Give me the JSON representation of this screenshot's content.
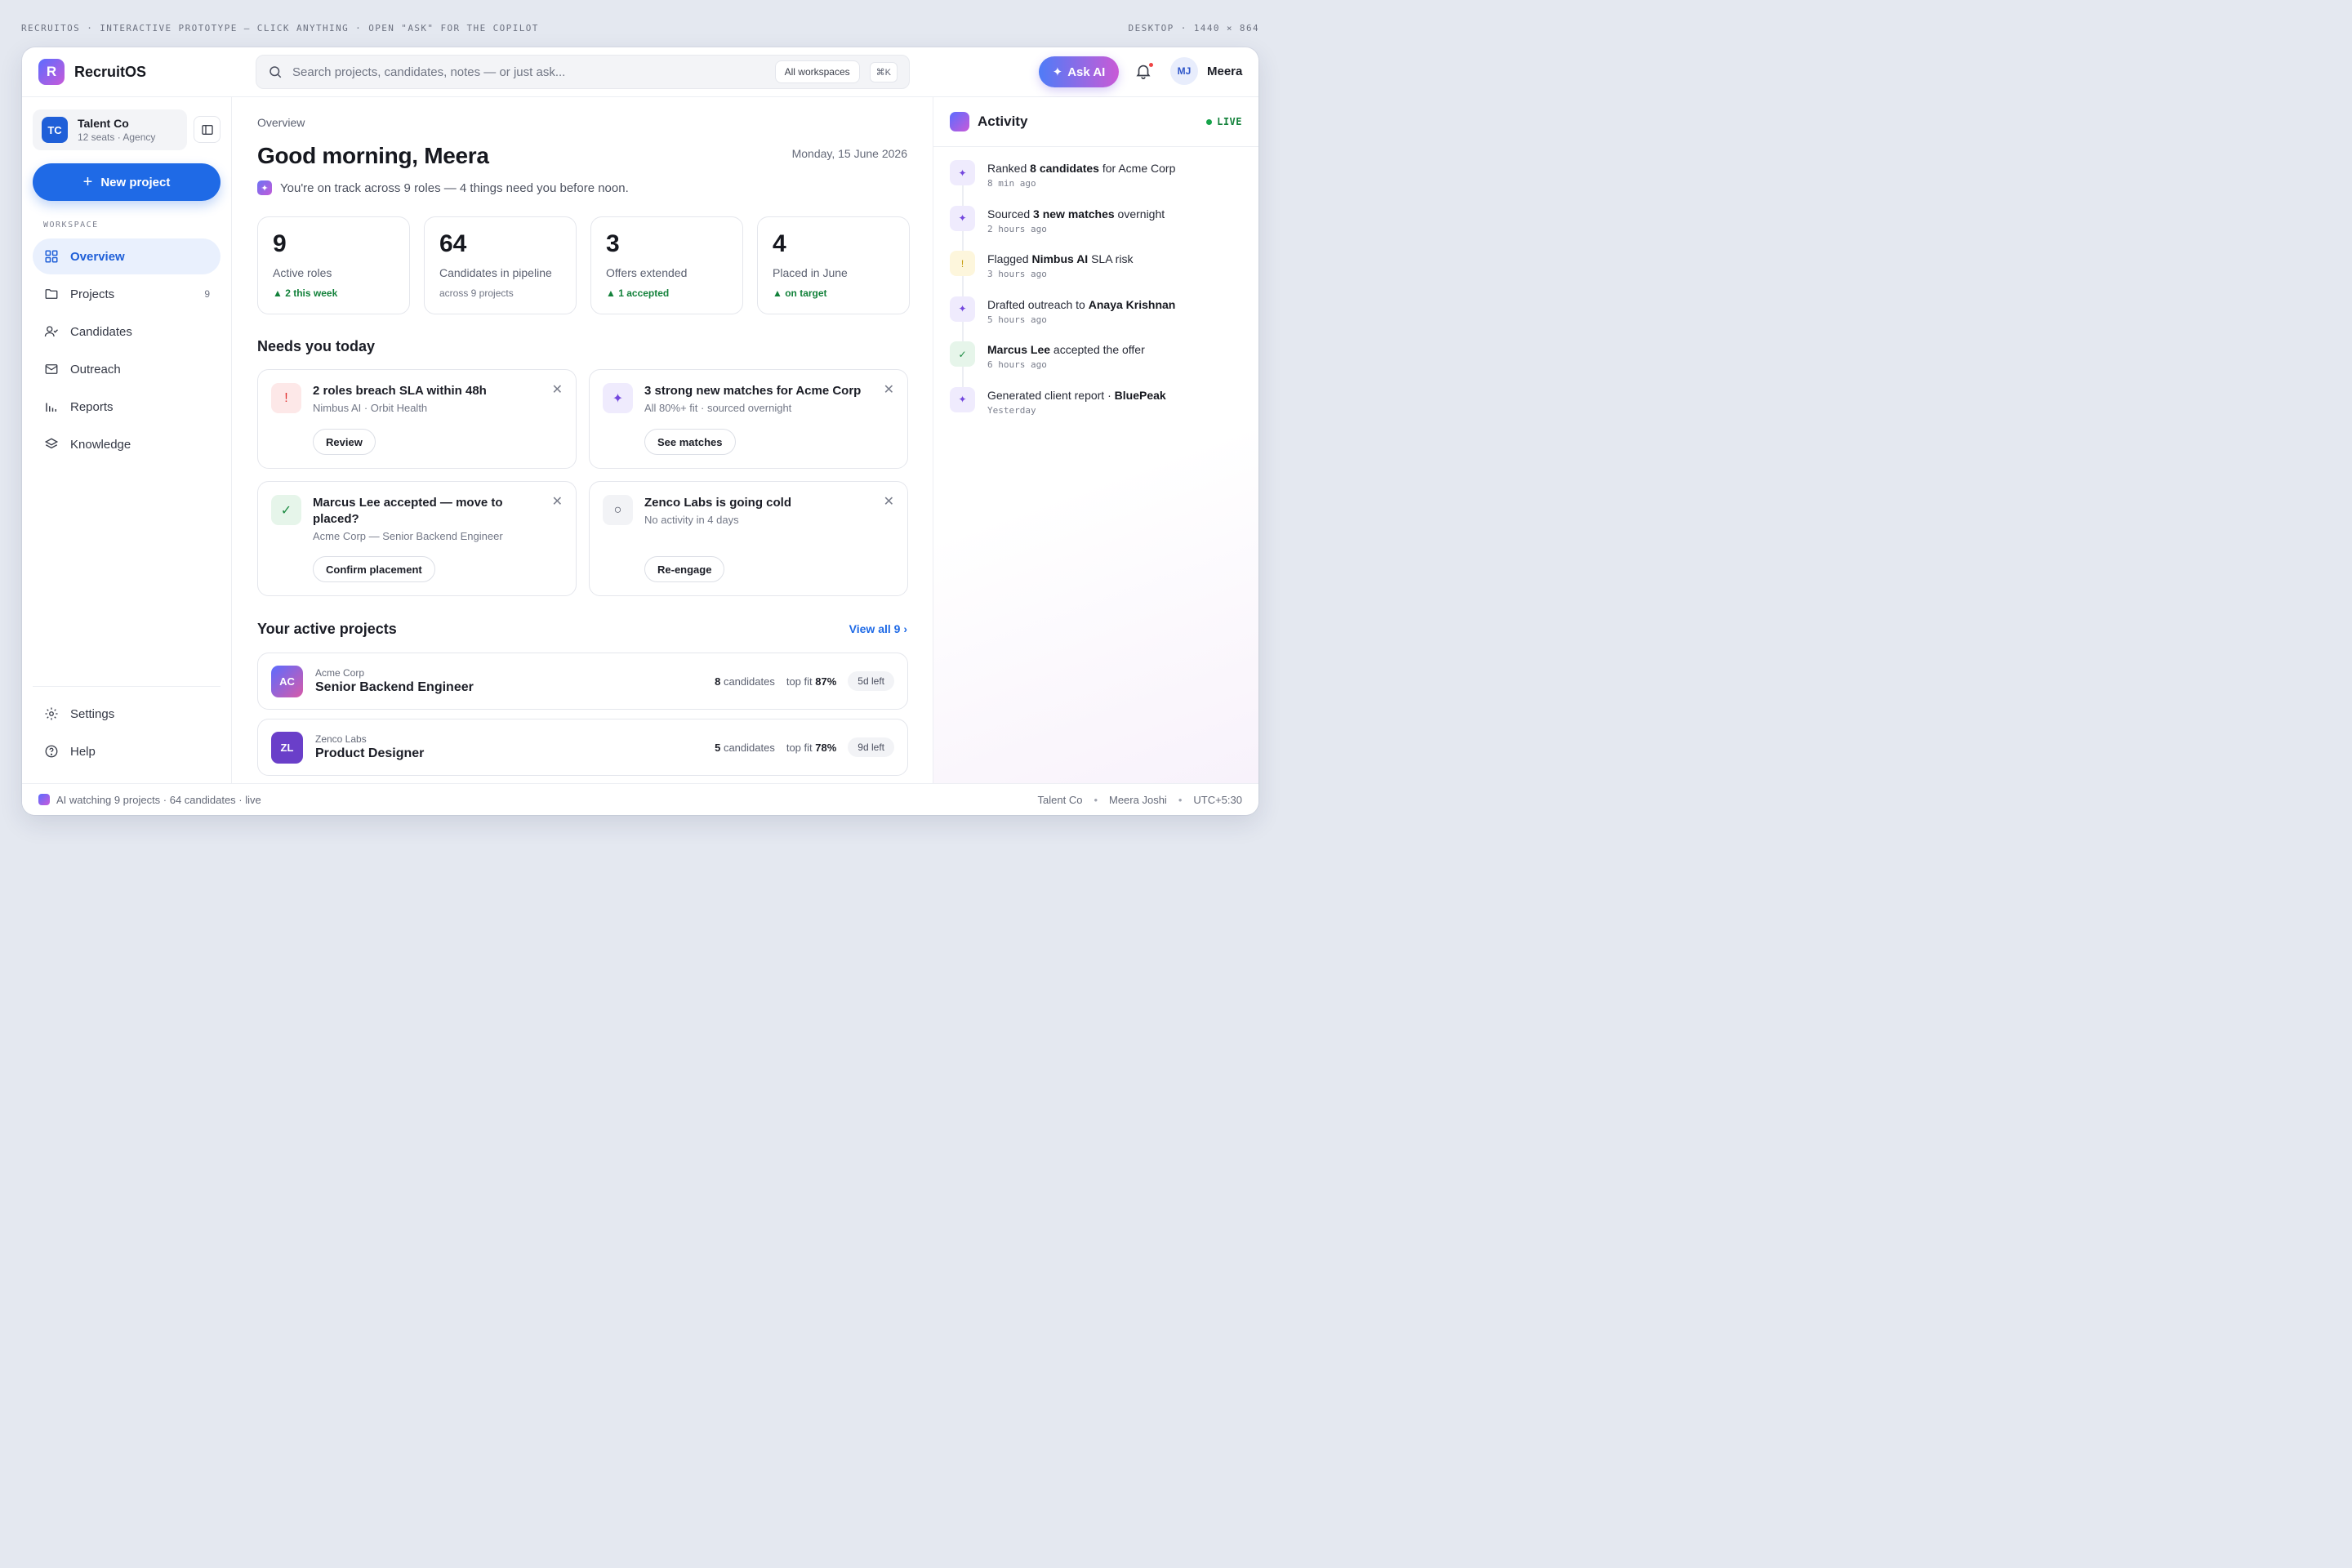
{
  "caption": {
    "left": "RECRUITOS · INTERACTIVE PROTOTYPE — CLICK ANYTHING · OPEN \"ASK\" FOR THE COPILOT",
    "right": "DESKTOP · 1440 × 864"
  },
  "header": {
    "brand_letter": "R",
    "brand_name": "RecruitOS",
    "search_placeholder": "Search projects, candidates, notes — or just ask...",
    "workspace_filter": "All workspaces",
    "shortcut": "⌘K",
    "ask_ai": "Ask AI",
    "user_initials": "MJ",
    "user_name": "Meera"
  },
  "sidebar": {
    "org_initials": "TC",
    "org_name": "Talent Co",
    "org_sub": "12 seats · Agency",
    "new_project": "New project",
    "section_label": "WORKSPACE",
    "items": [
      {
        "label": "Overview",
        "icon": "grid-icon"
      },
      {
        "label": "Projects",
        "icon": "folder-icon",
        "count": "9"
      },
      {
        "label": "Candidates",
        "icon": "user-check-icon"
      },
      {
        "label": "Outreach",
        "icon": "mail-icon"
      },
      {
        "label": "Reports",
        "icon": "bar-chart-icon"
      },
      {
        "label": "Knowledge",
        "icon": "layers-icon"
      }
    ],
    "bottom_items": [
      {
        "label": "Settings",
        "icon": "gear-icon"
      },
      {
        "label": "Help",
        "icon": "help-icon"
      }
    ]
  },
  "main": {
    "breadcrumb": "Overview",
    "greeting": "Good morning, Meera",
    "date": "Monday, 15 June 2026",
    "tagline": "You're on track across 9 roles — 4 things need you before noon.",
    "stats": [
      {
        "value": "9",
        "label": "Active roles",
        "sub": "▲ 2 this week"
      },
      {
        "value": "64",
        "label": "Candidates in pipeline",
        "sub": "across 9 projects"
      },
      {
        "value": "3",
        "label": "Offers extended",
        "sub": "▲ 1 accepted"
      },
      {
        "value": "4",
        "label": "Placed in June",
        "sub": "▲ on target"
      }
    ],
    "needs_title": "Needs you today",
    "tasks": [
      {
        "icon_glyph": "!",
        "title": "2 roles breach SLA within 48h",
        "sub": "Nimbus AI · Orbit Health",
        "action": "Review"
      },
      {
        "icon_glyph": "✦",
        "title": "3 strong new matches for Acme Corp",
        "sub": "All 80%+ fit · sourced overnight",
        "action": "See matches"
      },
      {
        "icon_glyph": "✓",
        "title": "Marcus Lee accepted — move to placed?",
        "sub": "Acme Corp — Senior Backend Engineer",
        "action": "Confirm placement"
      },
      {
        "icon_glyph": "○",
        "title": "Zenco Labs is going cold",
        "sub": "No activity in 4 days",
        "action": "Re-engage"
      }
    ],
    "projects_title": "Your active projects",
    "view_all": "View all 9 ›",
    "projects": [
      {
        "initials": "AC",
        "client": "Acme Corp",
        "role": "Senior Backend Engineer",
        "candidates_num": "8",
        "candidates_word": "candidates",
        "fit_label": "top fit",
        "fit": "87%",
        "days": "5d left"
      },
      {
        "initials": "ZL",
        "client": "Zenco Labs",
        "role": "Product Designer",
        "candidates_num": "5",
        "candidates_word": "candidates",
        "fit_label": "top fit",
        "fit": "78%",
        "days": "9d left"
      }
    ]
  },
  "activity": {
    "title": "Activity",
    "live": "LIVE",
    "items": [
      {
        "pre": "Ranked ",
        "bold": "8 candidates",
        "post": " for Acme Corp",
        "time": "8 min ago",
        "glyph": "✦"
      },
      {
        "pre": "Sourced ",
        "bold": "3 new matches",
        "post": " overnight",
        "time": "2 hours ago",
        "glyph": "✦"
      },
      {
        "pre": "Flagged ",
        "bold": "Nimbus AI",
        "post": " SLA risk",
        "time": "3 hours ago",
        "glyph": "!"
      },
      {
        "pre": "Drafted outreach to ",
        "bold": "Anaya Krishnan",
        "post": "",
        "time": "5 hours ago",
        "glyph": "✦"
      },
      {
        "pre": "",
        "bold": "Marcus Lee",
        "post": " accepted the offer",
        "time": "6 hours ago",
        "glyph": "✓"
      },
      {
        "pre": "Generated client report · ",
        "bold": "BluePeak",
        "post": "",
        "time": "Yesterday",
        "glyph": "✦"
      }
    ]
  },
  "footer": {
    "status": "AI watching 9 projects · 64 candidates · live",
    "org": "Talent Co",
    "user": "Meera Joshi",
    "tz": "UTC+5:30",
    "sep": "•"
  },
  "colors": {
    "primary": "#1f6ae6",
    "success": "#12813a",
    "danger": "#e0302f",
    "accent_start": "#5b6cff",
    "accent_end": "#c85ad9"
  }
}
